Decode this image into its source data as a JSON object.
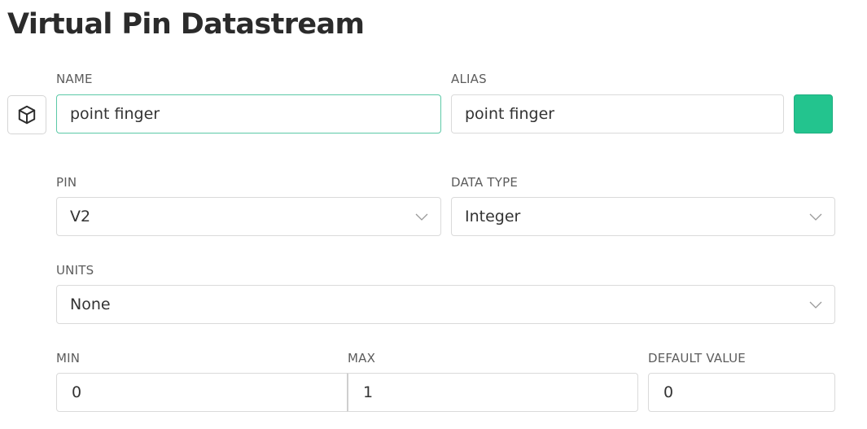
{
  "page": {
    "title": "Virtual Pin Datastream"
  },
  "name": {
    "label": "NAME",
    "value": "point finger",
    "icon": "cube-icon"
  },
  "alias": {
    "label": "ALIAS",
    "value": "point finger"
  },
  "color": {
    "value": "#23c48e"
  },
  "pin": {
    "label": "PIN",
    "value": "V2"
  },
  "data_type": {
    "label": "DATA TYPE",
    "value": "Integer"
  },
  "units": {
    "label": "UNITS",
    "value": "None"
  },
  "min": {
    "label": "MIN",
    "value": "0"
  },
  "max": {
    "label": "MAX",
    "value": "1"
  },
  "default_value": {
    "label": "DEFAULT VALUE",
    "value": "0"
  },
  "theme": {
    "focus_border": "#5cc9a7",
    "border": "#dadada",
    "swatch": "#23c48e"
  }
}
